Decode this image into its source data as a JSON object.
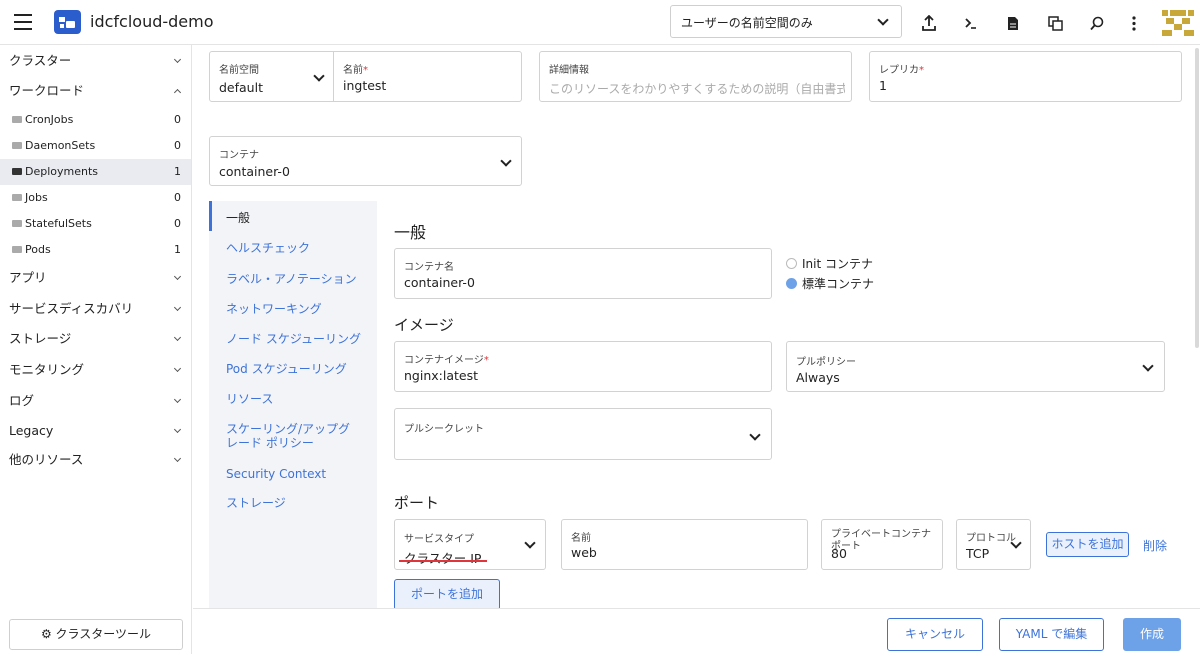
{
  "header": {
    "app_title": "idcfcloud-demo",
    "namespace_filter": "ユーザーの名前空間のみ",
    "icons": [
      "upload-icon",
      "terminal-icon",
      "file-icon",
      "copy-icon",
      "search-icon",
      "more-vertical-icon"
    ]
  },
  "sidebar": {
    "groups": {
      "cluster": "クラスター",
      "workload": "ワークロード",
      "apps": "アプリ",
      "service_discovery": "サービスディスカバリ",
      "storage": "ストレージ",
      "monitoring": "モニタリング",
      "logging": "ログ",
      "legacy": "Legacy",
      "more_resources": "他のリソース"
    },
    "items": [
      {
        "label": "CronJobs",
        "count": "0"
      },
      {
        "label": "DaemonSets",
        "count": "0"
      },
      {
        "label": "Deployments",
        "count": "1"
      },
      {
        "label": "Jobs",
        "count": "0"
      },
      {
        "label": "StatefulSets",
        "count": "0"
      },
      {
        "label": "Pods",
        "count": "1"
      }
    ],
    "cluster_tools": "クラスターツール"
  },
  "form": {
    "namespace": {
      "label": "名前空間",
      "value": "default"
    },
    "name": {
      "label": "名前",
      "required": "*",
      "value": "ingtest"
    },
    "description": {
      "label": "詳細情報",
      "placeholder": "このリソースをわかりやすくするための説明（自由書式）"
    },
    "replicas": {
      "label": "レプリカ",
      "required": "*",
      "value": "1"
    },
    "container": {
      "label": "コンテナ",
      "value": "container-0"
    }
  },
  "tabs": [
    "一般",
    "ヘルスチェック",
    "ラベル・アノテーション",
    "ネットワーキング",
    "ノード スケジューリング",
    "Pod スケジューリング",
    "リソース",
    "スケーリング/アップグレード ポリシー",
    "Security Context",
    "ストレージ"
  ],
  "general": {
    "title": "一般",
    "container_name": {
      "label": "コンテナ名",
      "value": "container-0"
    },
    "init_container": "Init コンテナ",
    "standard_container": "標準コンテナ"
  },
  "image": {
    "title": "イメージ",
    "container_image": {
      "label": "コンテナイメージ",
      "required": "*",
      "value": "nginx:latest"
    },
    "pull_policy": {
      "label": "プルポリシー",
      "value": "Always"
    },
    "pull_secret": {
      "label": "プルシークレット",
      "value": ""
    }
  },
  "ports": {
    "title": "ポート",
    "service_type": {
      "label": "サービスタイプ",
      "value": "クラスター IP"
    },
    "name": {
      "label": "名前",
      "value": "web"
    },
    "private_port": {
      "label": "プライベートコンテナポート",
      "value": "80"
    },
    "protocol": {
      "label": "プロトコル",
      "value": "TCP"
    },
    "add_host": "ホストを追加",
    "delete": "削除",
    "add_port": "ポートを追加"
  },
  "footer": {
    "cancel": "キャンセル",
    "edit_yaml": "YAML で編集",
    "create": "作成"
  },
  "colors": {
    "accent": "#3d73d8",
    "primary_button": "#6ea2e8",
    "required": "#e0353b",
    "underline": "#e0353b"
  }
}
